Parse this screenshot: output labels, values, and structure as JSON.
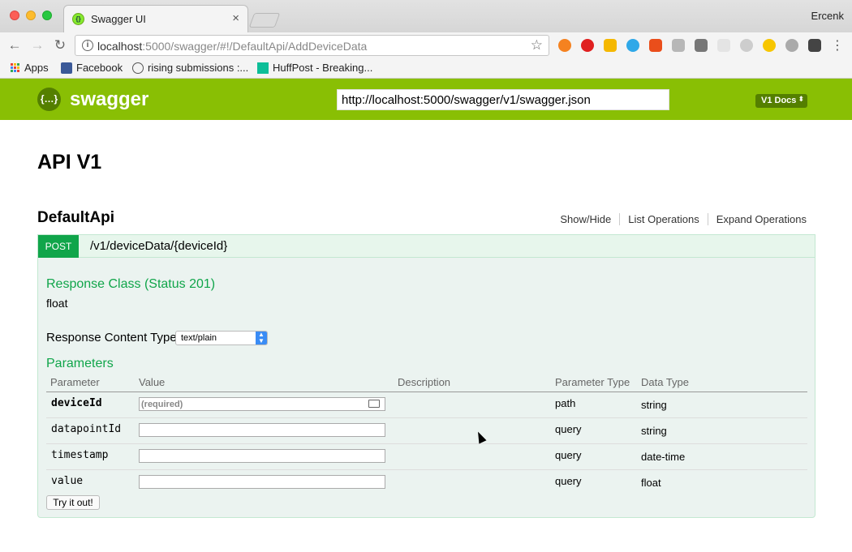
{
  "browser": {
    "tab_title": "Swagger UI",
    "tab_close": "×",
    "user_name": "Ercenk",
    "url_host": "localhost",
    "url_rest": ":5000/swagger/#!/DefaultApi/AddDeviceData",
    "bookmarks": [
      {
        "label": "Apps"
      },
      {
        "label": "Facebook"
      },
      {
        "label": "rising submissions :..."
      },
      {
        "label": "HuffPost - Breaking..."
      }
    ]
  },
  "swagger_header": {
    "brand": "swagger",
    "logo_glyph": "{…}",
    "spec_url": "http://localhost:5000/swagger/v1/swagger.json",
    "docs_select": "V1 Docs"
  },
  "api": {
    "title": "API V1",
    "resource": {
      "name": "DefaultApi",
      "links": [
        "Show/Hide",
        "List Operations",
        "Expand Operations"
      ]
    },
    "operation": {
      "method": "POST",
      "path": "/v1/deviceData/{deviceId}",
      "response_class_heading": "Response Class (Status 201)",
      "response_class_value": "float",
      "response_content_type_label": "Response Content Type",
      "response_content_type_value": "text/plain",
      "parameters_heading": "Parameters",
      "param_columns": [
        "Parameter",
        "Value",
        "Description",
        "Parameter Type",
        "Data Type"
      ],
      "params": [
        {
          "name": "deviceId",
          "value_placeholder": "(required)",
          "param_type": "path",
          "data_type": "string"
        },
        {
          "name": "datapointId",
          "value_placeholder": "",
          "param_type": "query",
          "data_type": "string"
        },
        {
          "name": "timestamp",
          "value_placeholder": "",
          "param_type": "query",
          "data_type": "date-time"
        },
        {
          "name": "value",
          "value_placeholder": "",
          "param_type": "query",
          "data_type": "float"
        }
      ],
      "try_button": "Try it out!"
    }
  },
  "colors": {
    "swagger_green": "#89bf04",
    "post_green": "#10a54a"
  }
}
